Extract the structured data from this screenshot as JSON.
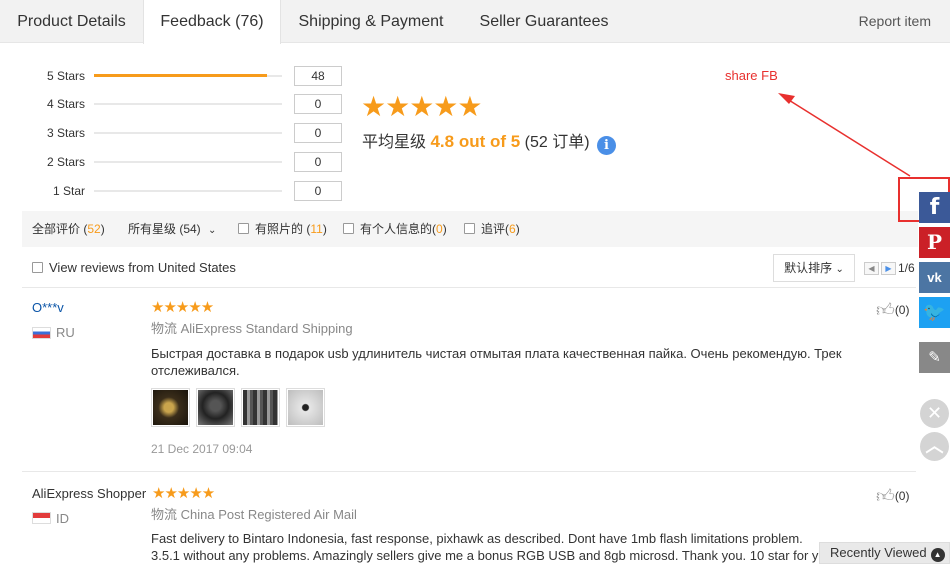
{
  "tabs": [
    {
      "label": "Product Details"
    },
    {
      "label": "Feedback (76)"
    },
    {
      "label": "Shipping & Payment"
    },
    {
      "label": "Seller Guarantees"
    }
  ],
  "report_item": "Report item",
  "rating": {
    "distribution": [
      {
        "label": "5 Stars",
        "count": "48",
        "fraction": 0.92
      },
      {
        "label": "4 Stars",
        "count": "0",
        "fraction": 0
      },
      {
        "label": "3 Stars",
        "count": "0",
        "fraction": 0
      },
      {
        "label": "2 Stars",
        "count": "0",
        "fraction": 0
      },
      {
        "label": "1 Star",
        "count": "0",
        "fraction": 0
      }
    ],
    "stars": "★★★★★",
    "avg_prefix": "平均星级",
    "avg_value": "4.8 out of 5",
    "orders": "(52 订单)",
    "info_glyph": "i"
  },
  "annotation": {
    "text": "share FB",
    "color": "#e8302e"
  },
  "filters": {
    "all_label": "全部评价 (",
    "all_count": "52",
    "all_close": ")",
    "stars_select": "所有星级 (54)",
    "photos_label": "有照片的 (",
    "photos_count": "11",
    "photos_close": ")",
    "info_label": "有个人信息的(",
    "info_count": "0",
    "info_close": ")",
    "followup_label": "追评(",
    "followup_count": "6",
    "followup_close": ")"
  },
  "us_reviews_label": "View reviews from United States",
  "sort_label": "默认排序",
  "pager": {
    "text": "1/6"
  },
  "reviews": [
    {
      "name": "O***v",
      "country": "RU",
      "stars": "★★★★★",
      "shipping": "物流 AliExpress Standard Shipping",
      "text": "Быстрая доставка в подарок usb удлинитель чистая отмытая плата качественная пайка. Очень рекомендую. Трек отслеживался.",
      "date": "21 Dec 2017 09:04",
      "likes": "(0)"
    },
    {
      "name": "AliExpress Shopper",
      "country": "ID",
      "stars": "★★★★★",
      "shipping": "物流 China Post Registered Air Mail",
      "text": "Fast delivery to Bintaro Indonesia, fast response, pixhawk as described. Dont have 1mb flash limitations problem. 3.5.1 without any problems. Amazingly sellers give me a bonus RGB USB and 8gb microsd. Thank you. 10 star for y",
      "likes": "(0)"
    }
  ],
  "share": {
    "facebook": "f",
    "pinterest": "P",
    "vk": "vk",
    "twitter": "🐦",
    "edit": "✎",
    "close": "✕",
    "up": "︿"
  },
  "recently_viewed": "Recently Viewed",
  "colors": {
    "accent": "#f79b1b",
    "link": "#0b55a8",
    "annotation": "#e8302e"
  }
}
